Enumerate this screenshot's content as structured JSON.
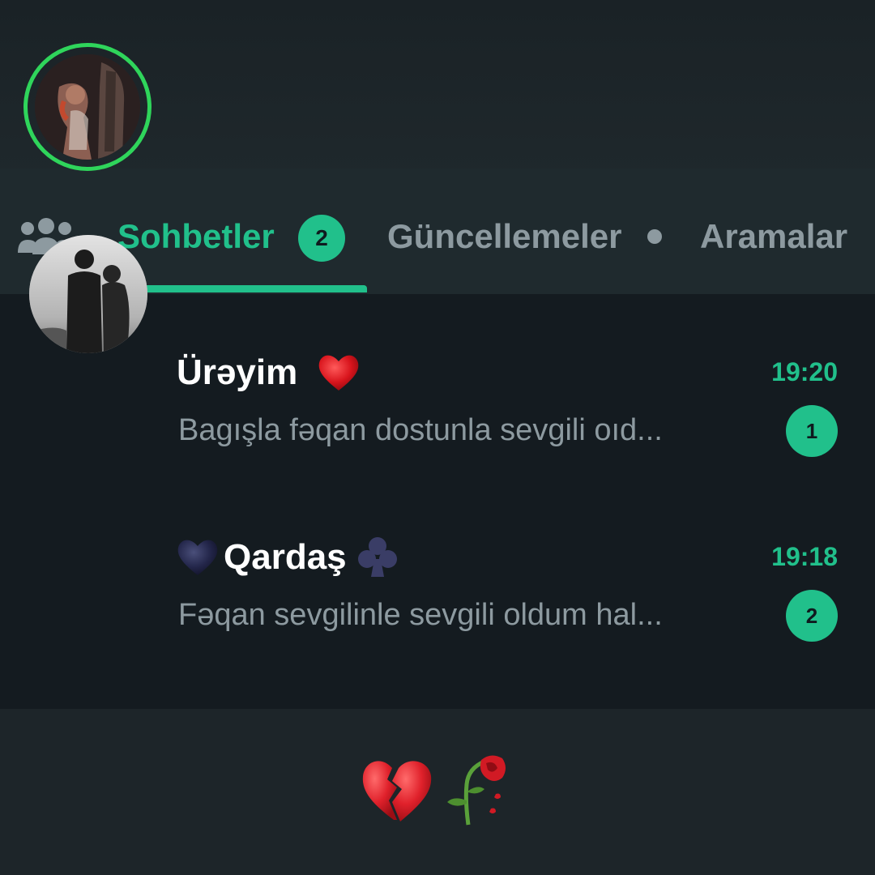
{
  "tabs": {
    "community_icon": "community-icon",
    "items": [
      {
        "label": "Sohbetler",
        "badge": "2",
        "active": true
      },
      {
        "label": "Güncellemeler",
        "has_dot": true
      },
      {
        "label": "Aramalar"
      }
    ]
  },
  "chats": [
    {
      "name": "Ürəyim",
      "name_icon": "red-heart-icon",
      "preview": "Bagışla fəqan dostunla sevgili oıd...",
      "time": "19:20",
      "unread": "1",
      "avatar": "avatar-with-status-ring"
    },
    {
      "name": "Qardaş",
      "name_prefix_icon": "black-heart-icon",
      "name_suffix_icon": "club-suit-icon",
      "preview": "Fəqan sevgilinle sevgili oldum hal...",
      "time": "19:18",
      "unread": "2",
      "avatar": "silhouette-avatar"
    }
  ],
  "footer_icons": [
    "broken-heart-icon",
    "wilted-rose-icon"
  ],
  "colors": {
    "accent": "#21c08b",
    "status_ring": "#2fd55b",
    "background": "#1d2529",
    "list_background": "#141b20",
    "muted_text": "#8d9aa0"
  }
}
